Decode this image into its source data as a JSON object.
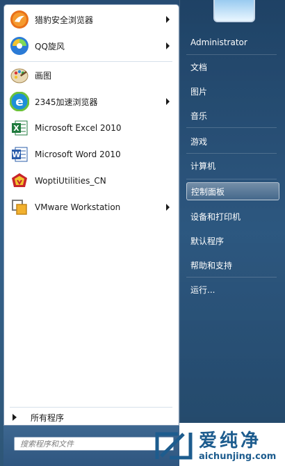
{
  "left_items": [
    {
      "label": "猎豹安全浏览器",
      "icon": "cheetah-browser-icon",
      "has_submenu": true
    },
    {
      "label": "QQ旋风",
      "icon": "qq-whirlwind-icon",
      "has_submenu": true
    },
    {
      "label": "画图",
      "icon": "paint-icon",
      "has_submenu": false
    },
    {
      "label": "2345加速浏览器",
      "icon": "2345-browser-icon",
      "has_submenu": true
    },
    {
      "label": "Microsoft Excel 2010",
      "icon": "excel-icon",
      "has_submenu": false
    },
    {
      "label": "Microsoft Word 2010",
      "icon": "word-icon",
      "has_submenu": false
    },
    {
      "label": "WoptiUtilities_CN",
      "icon": "wopti-icon",
      "has_submenu": false
    },
    {
      "label": "VMware Workstation",
      "icon": "vmware-icon",
      "has_submenu": true
    }
  ],
  "all_programs": "所有程序",
  "search": {
    "placeholder": "搜索程序和文件"
  },
  "right_items": [
    {
      "label": "Administrator",
      "active": false
    },
    {
      "label": "文档",
      "active": false
    },
    {
      "label": "图片",
      "active": false
    },
    {
      "label": "音乐",
      "active": false
    },
    {
      "label": "游戏",
      "active": false
    },
    {
      "label": "计算机",
      "active": false
    },
    {
      "label": "控制面板",
      "active": true
    },
    {
      "label": "设备和打印机",
      "active": false
    },
    {
      "label": "默认程序",
      "active": false
    },
    {
      "label": "帮助和支持",
      "active": false
    },
    {
      "label": "运行...",
      "active": false
    }
  ],
  "watermark": {
    "text": "爱纯净",
    "url": "aichunjing.com"
  }
}
